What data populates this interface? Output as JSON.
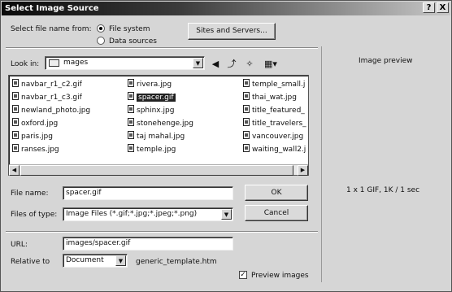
{
  "window": {
    "title": "Select Image Source",
    "help_label": "?",
    "close_label": "X"
  },
  "source": {
    "label": "Select file name from:",
    "options": [
      {
        "label": "File system",
        "selected": true
      },
      {
        "label": "Data sources",
        "selected": false
      }
    ],
    "sites_button": "Sites and Servers..."
  },
  "lookin": {
    "label": "Look in:",
    "folder": "mages"
  },
  "toolbar_icons": [
    "back-icon",
    "up-folder-icon",
    "new-folder-icon",
    "view-menu-icon"
  ],
  "files": {
    "col1": [
      "navbar_r1_c2.gif",
      "navbar_r1_c3.gif",
      "newland_photo.jpg",
      "oxford.jpg",
      "paris.jpg",
      "ranses.jpg"
    ],
    "col2": [
      "rivera.jpg",
      "spacer.gif",
      "sphinx.jpg",
      "stonehenge.jpg",
      "taj mahal.jpg",
      "temple.jpg"
    ],
    "col3": [
      "temple_small.j",
      "thai_wat.jpg",
      "title_featured_",
      "title_travelers_",
      "vancouver.jpg",
      "waiting_wall2.j"
    ],
    "selected": "spacer.gif"
  },
  "filename": {
    "label": "File name:",
    "value": "spacer.gif"
  },
  "filetype": {
    "label": "Files of type:",
    "value": "Image Files (*.gif;*.jpg;*.jpeg;*.png)"
  },
  "buttons": {
    "ok": "OK",
    "cancel": "Cancel"
  },
  "url": {
    "label": "URL:",
    "value": "images/spacer.gif"
  },
  "relative": {
    "label": "Relative to",
    "value": "Document",
    "doc": "generic_template.htm"
  },
  "preview": {
    "title": "Image preview",
    "info": "1 x 1 GIF, 1K / 1 sec",
    "checkbox_label": "Preview images",
    "checked": true
  }
}
